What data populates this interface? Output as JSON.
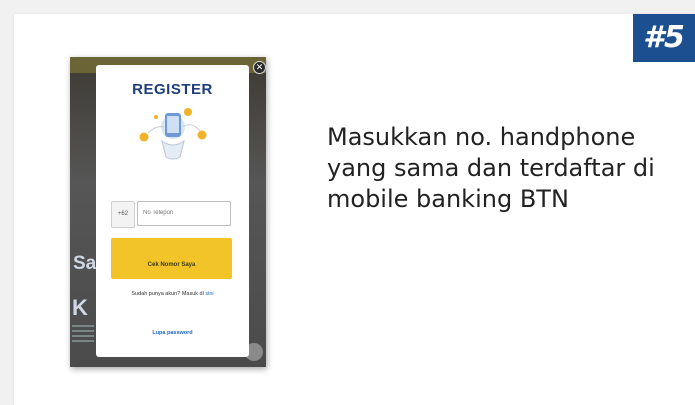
{
  "step_badge": "#5",
  "caption": "Masukkan no. handphone yang sama dan terdaftar di mobile banking BTN",
  "modal": {
    "title": "REGISTER",
    "country_code": "+62",
    "phone_placeholder": "No Telepon",
    "primary_button": "Cek Nomor Saya",
    "login_prompt": "Sudah punya akun? Masuk di",
    "login_link": "sini",
    "forgot_password": "Lupa password"
  },
  "icons": {
    "close": "close-icon",
    "illustration": "phone-coins-illustration"
  },
  "colors": {
    "badge": "#1b4f8f",
    "title": "#1e3f78",
    "button": "#f2c427",
    "link": "#1a67c8"
  }
}
